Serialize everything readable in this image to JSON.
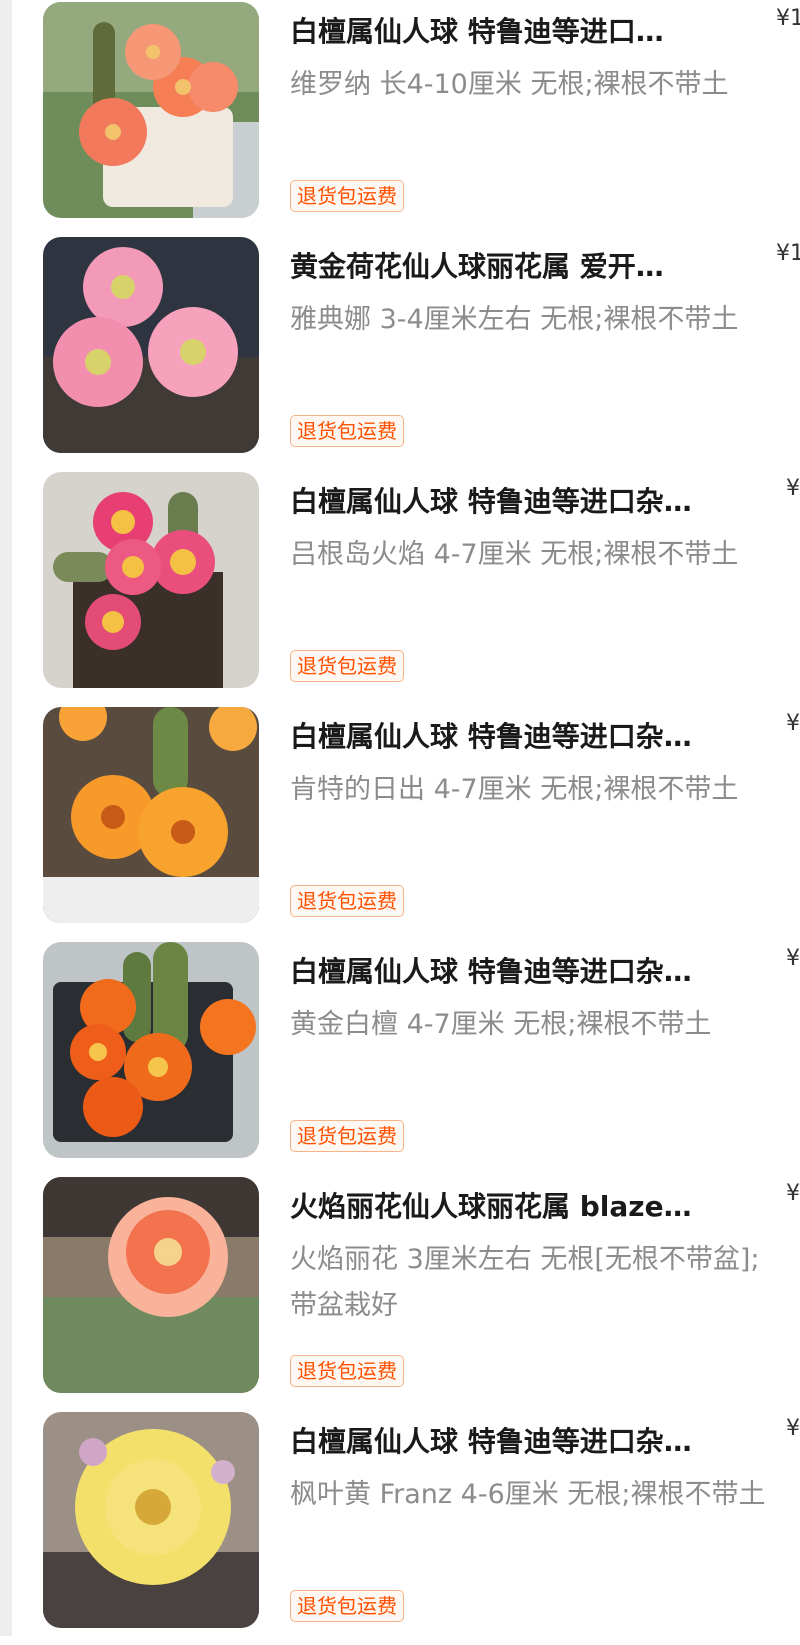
{
  "products": [
    {
      "title": "白檀属仙人球 特鲁迪等进口…",
      "subtitle": "维罗纳 长4-10厘米 无根;裸根不带土",
      "badge": "退货包运费",
      "price": "¥1",
      "image": "cactus-pot-orange-pink-flowers"
    },
    {
      "title": "黄金荷花仙人球丽花属 爱开…",
      "subtitle": "雅典娜 3-4厘米左右 无根;裸根不带土",
      "badge": "退货包运费",
      "price": "¥1",
      "image": "pink-lotus-cactus-flowers"
    },
    {
      "title": "白檀属仙人球 特鲁迪等进口杂…",
      "subtitle": "吕根岛火焰 4-7厘米 无根;裸根不带土",
      "badge": "退货包运费",
      "price": "¥",
      "image": "magenta-yellow-cactus-flowers"
    },
    {
      "title": "白檀属仙人球 特鲁迪等进口杂…",
      "subtitle": "肯特的日出 4-7厘米 无根;裸根不带土",
      "badge": "退货包运费",
      "price": "¥",
      "image": "orange-cactus-flowers"
    },
    {
      "title": "白檀属仙人球 特鲁迪等进口杂…",
      "subtitle": "黄金白檀 4-7厘米 无根;裸根不带土",
      "badge": "退货包运费",
      "price": "¥",
      "image": "orange-red-cactus-flowers-in-pot"
    },
    {
      "title": "火焰丽花仙人球丽花属 blaze…",
      "subtitle": "火焰丽花 3厘米左右 无根[无根不带盆];带盆栽好",
      "badge": "退货包运费",
      "price": "¥",
      "image": "coral-cactus-flower"
    },
    {
      "title": "白檀属仙人球 特鲁迪等进口杂…",
      "subtitle": "枫叶黄 Franz 4-6厘米 无根;裸根不带土",
      "badge": "退货包运费",
      "price": "¥",
      "image": "yellow-cactus-flower"
    }
  ],
  "colors": {
    "badge_text": "#ff5000",
    "title_text": "#1a1a1a",
    "subtitle_text": "#8c8c8c"
  }
}
